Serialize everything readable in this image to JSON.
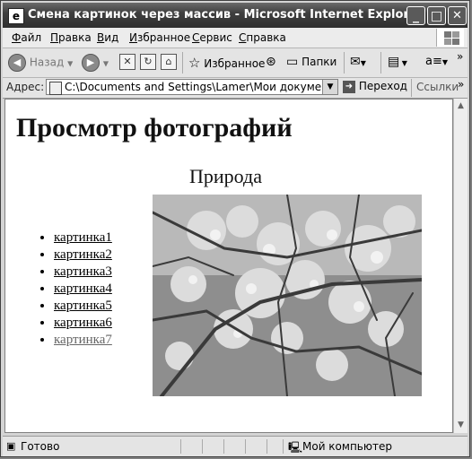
{
  "window": {
    "title": "Смена картинок через массив - Microsoft Internet Explorer",
    "controls": {
      "minimize": "_",
      "maximize": "□",
      "close": "✕"
    }
  },
  "menu": [
    "Файл",
    "Правка",
    "Вид",
    "Избранное",
    "Сервис",
    "Справка"
  ],
  "toolbar": {
    "back": "Назад",
    "favorites": "Избранное",
    "folders": "Папки"
  },
  "address": {
    "label": "Адрес:",
    "url": "C:\\Documents and Settings\\Lamer\\Мои документы\\УЧЕБА",
    "go": "Переход",
    "links": "Ссылки"
  },
  "page": {
    "heading": "Просмотр фотографий",
    "photo_title": "Природа",
    "links": [
      {
        "label": "картинка1",
        "visited": false
      },
      {
        "label": "картинка2",
        "visited": false
      },
      {
        "label": "картинка3",
        "visited": false
      },
      {
        "label": "картинка4",
        "visited": false
      },
      {
        "label": "картинка5",
        "visited": false
      },
      {
        "label": "картинка6",
        "visited": false
      },
      {
        "label": "картинка7",
        "visited": true
      }
    ]
  },
  "status": {
    "text": "Готово",
    "zone": "Мой компьютер"
  }
}
